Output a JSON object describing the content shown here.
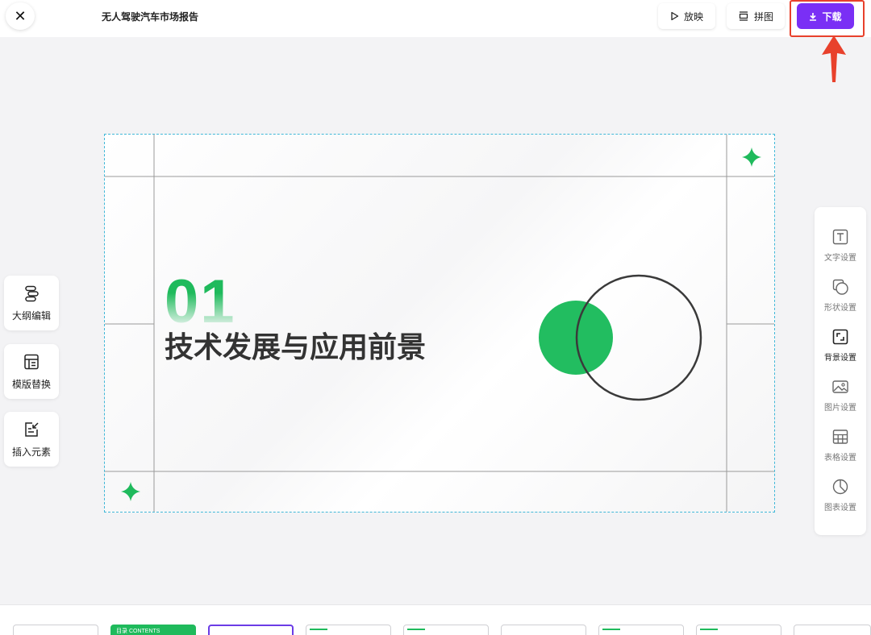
{
  "topbar": {
    "close_label": "✕",
    "doc_title": "无人驾驶汽车市场报告",
    "play_label": "放映",
    "collage_label": "拼图",
    "download_label": "下载"
  },
  "left_tools": [
    {
      "label": "大纲编辑",
      "icon": "outline-icon"
    },
    {
      "label": "模版替换",
      "icon": "template-icon"
    },
    {
      "label": "插入元素",
      "icon": "insert-icon"
    }
  ],
  "right_panel": [
    {
      "label": "文字设置",
      "icon": "text-icon"
    },
    {
      "label": "形状设置",
      "icon": "shape-icon"
    },
    {
      "label": "背景设置",
      "icon": "background-icon"
    },
    {
      "label": "图片设置",
      "icon": "image-icon"
    },
    {
      "label": "表格设置",
      "icon": "table-icon"
    },
    {
      "label": "图表设置",
      "icon": "chart-icon"
    }
  ],
  "slide": {
    "number": "01",
    "title": "技术发展与应用前景"
  },
  "thumbnails": {
    "second_label": "目录  CONTENTS"
  },
  "colors": {
    "accent": "#7a2ff5",
    "green": "#1fba5c",
    "highlight": "#e8412c"
  }
}
